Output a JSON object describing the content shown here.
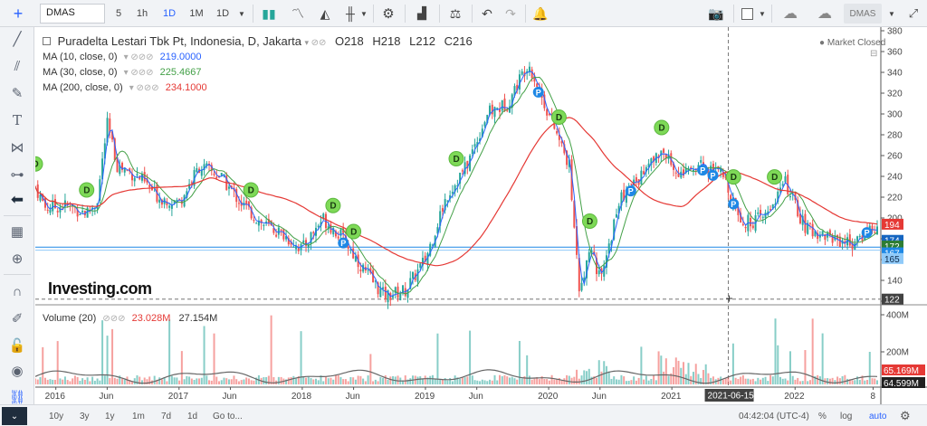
{
  "toolbar": {
    "symbol": "DMAS",
    "intervals": [
      "5",
      "1h",
      "1D",
      "1M",
      "1D"
    ],
    "active_interval": 2,
    "right_symbol": "DMAS"
  },
  "legend": {
    "title": "Puradelta Lestari Tbk Pt, Indonesia, D, Jakarta",
    "o": "O218",
    "h": "H218",
    "l": "L212",
    "c": "C216",
    "ma10_label": "MA (10, close, 0)",
    "ma10_value": "219.0000",
    "ma30_label": "MA (30, close, 0)",
    "ma30_value": "225.4667",
    "ma200_label": "MA (200, close, 0)",
    "ma200_value": "234.1000",
    "market_status": "Market Closed",
    "logo": "Investing.com"
  },
  "volume_legend": {
    "label": "Volume (20)",
    "v1": "23.028M",
    "v2": "27.154M"
  },
  "price_axis": [
    "380",
    "360",
    "340",
    "320",
    "300",
    "280",
    "260",
    "240",
    "220",
    "200",
    "180",
    "160",
    "140",
    "120"
  ],
  "price_badges": [
    {
      "text": "194",
      "bg": "#e53935"
    },
    {
      "text": "174",
      "bg": "#1565c0"
    },
    {
      "text": "172",
      "bg": "#2e7d32"
    },
    {
      "text": "167",
      "bg": "#1e88e5"
    },
    {
      "text": "165",
      "bg": "#90caf9"
    },
    {
      "text": "122",
      "bg": "#424242"
    }
  ],
  "volume_axis": [
    "400M",
    "200M"
  ],
  "volume_badges": [
    {
      "text": "65.169M",
      "bg": "#e53935"
    },
    {
      "text": "64.599M",
      "bg": "#212121"
    }
  ],
  "time_axis": [
    "2016",
    "Jun",
    "2017",
    "Jun",
    "2018",
    "Jun",
    "2019",
    "Jun",
    "2020",
    "Jun",
    "2021",
    "2022",
    "8"
  ],
  "crosshair_date": "2021-06-15",
  "bottombar": {
    "ranges": [
      "10y",
      "3y",
      "1y",
      "1m",
      "7d",
      "1d"
    ],
    "goto": "Go to...",
    "time": "04:42:04 (UTC-4)",
    "percent": "%",
    "log": "log",
    "auto": "auto"
  },
  "colors": {
    "up": "#26a69a",
    "down": "#ef5350",
    "ma10": "#2962ff",
    "ma30": "#43a047",
    "ma200": "#e53935",
    "dividend": "#7ed957",
    "p_marker": "#1e88e5"
  },
  "chart_data": {
    "type": "candlestick",
    "price_ylim": [
      120,
      380
    ],
    "price_series": [
      {
        "x": "2015-11",
        "close": 230
      },
      {
        "x": "2015-12",
        "close": 210
      },
      {
        "x": "2016-02",
        "close": 212
      },
      {
        "x": "2016-04",
        "close": 205
      },
      {
        "x": "2016-05",
        "close": 215
      },
      {
        "x": "2016-06",
        "close": 290
      },
      {
        "x": "2016-07",
        "close": 250
      },
      {
        "x": "2016-09",
        "close": 240
      },
      {
        "x": "2016-11",
        "close": 220
      },
      {
        "x": "2017-01",
        "close": 215
      },
      {
        "x": "2017-03",
        "close": 250
      },
      {
        "x": "2017-05",
        "close": 240
      },
      {
        "x": "2017-07",
        "close": 215
      },
      {
        "x": "2017-09",
        "close": 195
      },
      {
        "x": "2017-11",
        "close": 185
      },
      {
        "x": "2018-01",
        "close": 170
      },
      {
        "x": "2018-03",
        "close": 200
      },
      {
        "x": "2018-05",
        "close": 180
      },
      {
        "x": "2018-07",
        "close": 150
      },
      {
        "x": "2018-09",
        "close": 125
      },
      {
        "x": "2018-11",
        "close": 130
      },
      {
        "x": "2019-01",
        "close": 160
      },
      {
        "x": "2019-03",
        "close": 220
      },
      {
        "x": "2019-05",
        "close": 250
      },
      {
        "x": "2019-07",
        "close": 300
      },
      {
        "x": "2019-09",
        "close": 310
      },
      {
        "x": "2019-11",
        "close": 350
      },
      {
        "x": "2020-01",
        "close": 300
      },
      {
        "x": "2020-03",
        "close": 250
      },
      {
        "x": "2020-04",
        "close": 125
      },
      {
        "x": "2020-05",
        "close": 175
      },
      {
        "x": "2020-06",
        "close": 140
      },
      {
        "x": "2020-08",
        "close": 220
      },
      {
        "x": "2020-10",
        "close": 240
      },
      {
        "x": "2020-12",
        "close": 265
      },
      {
        "x": "2021-02",
        "close": 240
      },
      {
        "x": "2021-04",
        "close": 250
      },
      {
        "x": "2021-06",
        "close": 240
      },
      {
        "x": "2021-08",
        "close": 195
      },
      {
        "x": "2021-10",
        "close": 200
      },
      {
        "x": "2021-12",
        "close": 235
      },
      {
        "x": "2022-02",
        "close": 190
      },
      {
        "x": "2022-05",
        "close": 180
      },
      {
        "x": "2022-07",
        "close": 175
      },
      {
        "x": "2022-08",
        "close": 190
      }
    ],
    "dividend_markers": [
      "2015-11",
      "2016-04",
      "2017-08",
      "2018-04",
      "2018-06",
      "2019-04",
      "2020-02",
      "2020-05",
      "2020-12",
      "2021-07",
      "2021-11"
    ],
    "p_markers": [
      "2018-05",
      "2019-12",
      "2020-09",
      "2021-04",
      "2021-05",
      "2021-07",
      "2022-08"
    ]
  }
}
